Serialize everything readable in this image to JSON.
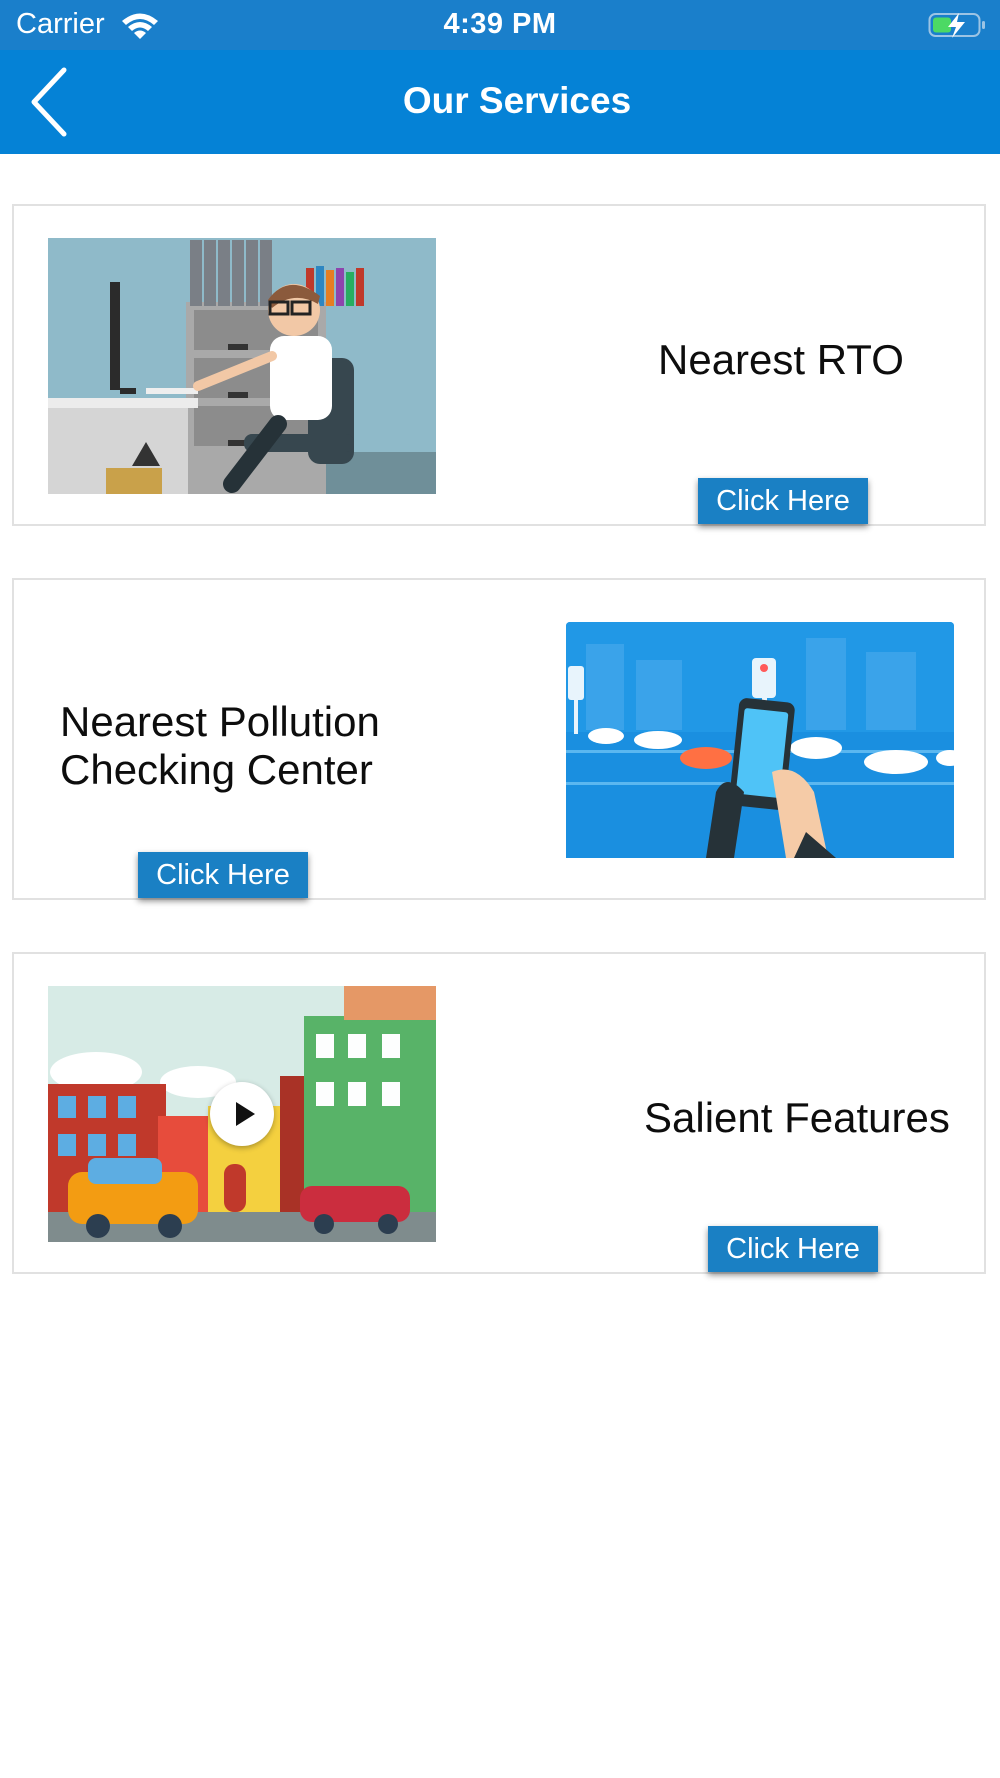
{
  "status_bar": {
    "carrier": "Carrier",
    "time": "4:39 PM"
  },
  "nav": {
    "title": "Our Services",
    "back_icon": "chevron-left-icon"
  },
  "services": [
    {
      "title": "Nearest RTO",
      "button_label": "Click Here",
      "image": "office-worker-illustration"
    },
    {
      "title_line1": "Nearest Pollution",
      "title_line2": "Checking Center",
      "button_label": "Click Here",
      "image": "traffic-phone-illustration"
    },
    {
      "title": "Salient Features",
      "button_label": "Click Here",
      "image": "city-street-video-thumbnail"
    }
  ],
  "colors": {
    "status_bar": "#1a7fcb",
    "nav_bar": "#0582d6",
    "button": "#1a80c4",
    "card_border": "#e1e1e1"
  }
}
